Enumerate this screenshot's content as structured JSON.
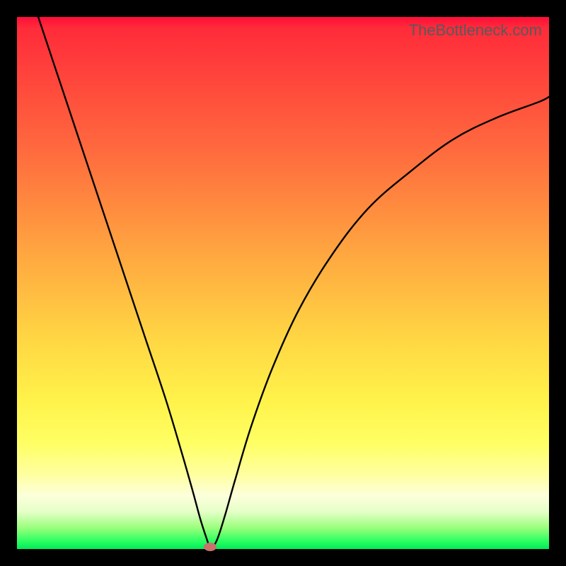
{
  "watermark": "TheBottleneck.com",
  "chart_data": {
    "type": "line",
    "title": "",
    "xlabel": "",
    "ylabel": "",
    "xlim": [
      0,
      100
    ],
    "ylim": [
      0,
      100
    ],
    "grid": false,
    "series": [
      {
        "name": "curve",
        "x": [
          4,
          8,
          12,
          16,
          20,
          24,
          28,
          31,
          33,
          34.5,
          35.8,
          36.3,
          37.5,
          39,
          41,
          44,
          48,
          53,
          59,
          66,
          74,
          82,
          90,
          98,
          100
        ],
        "y": [
          100,
          88,
          76,
          64,
          52,
          40,
          28,
          18,
          11,
          5.5,
          1.5,
          0.2,
          1.5,
          6,
          13,
          23,
          34,
          45,
          55,
          64,
          71,
          77,
          81,
          84,
          85
        ]
      }
    ],
    "marker": {
      "x": 36.3,
      "y": 0.4,
      "color": "#c9726d"
    },
    "background_gradient": {
      "top": "#ff0d3a",
      "mid_upper": "#ff6a3e",
      "mid": "#ffd543",
      "mid_lower": "#ffff63",
      "bottom": "#00eb5b"
    }
  }
}
